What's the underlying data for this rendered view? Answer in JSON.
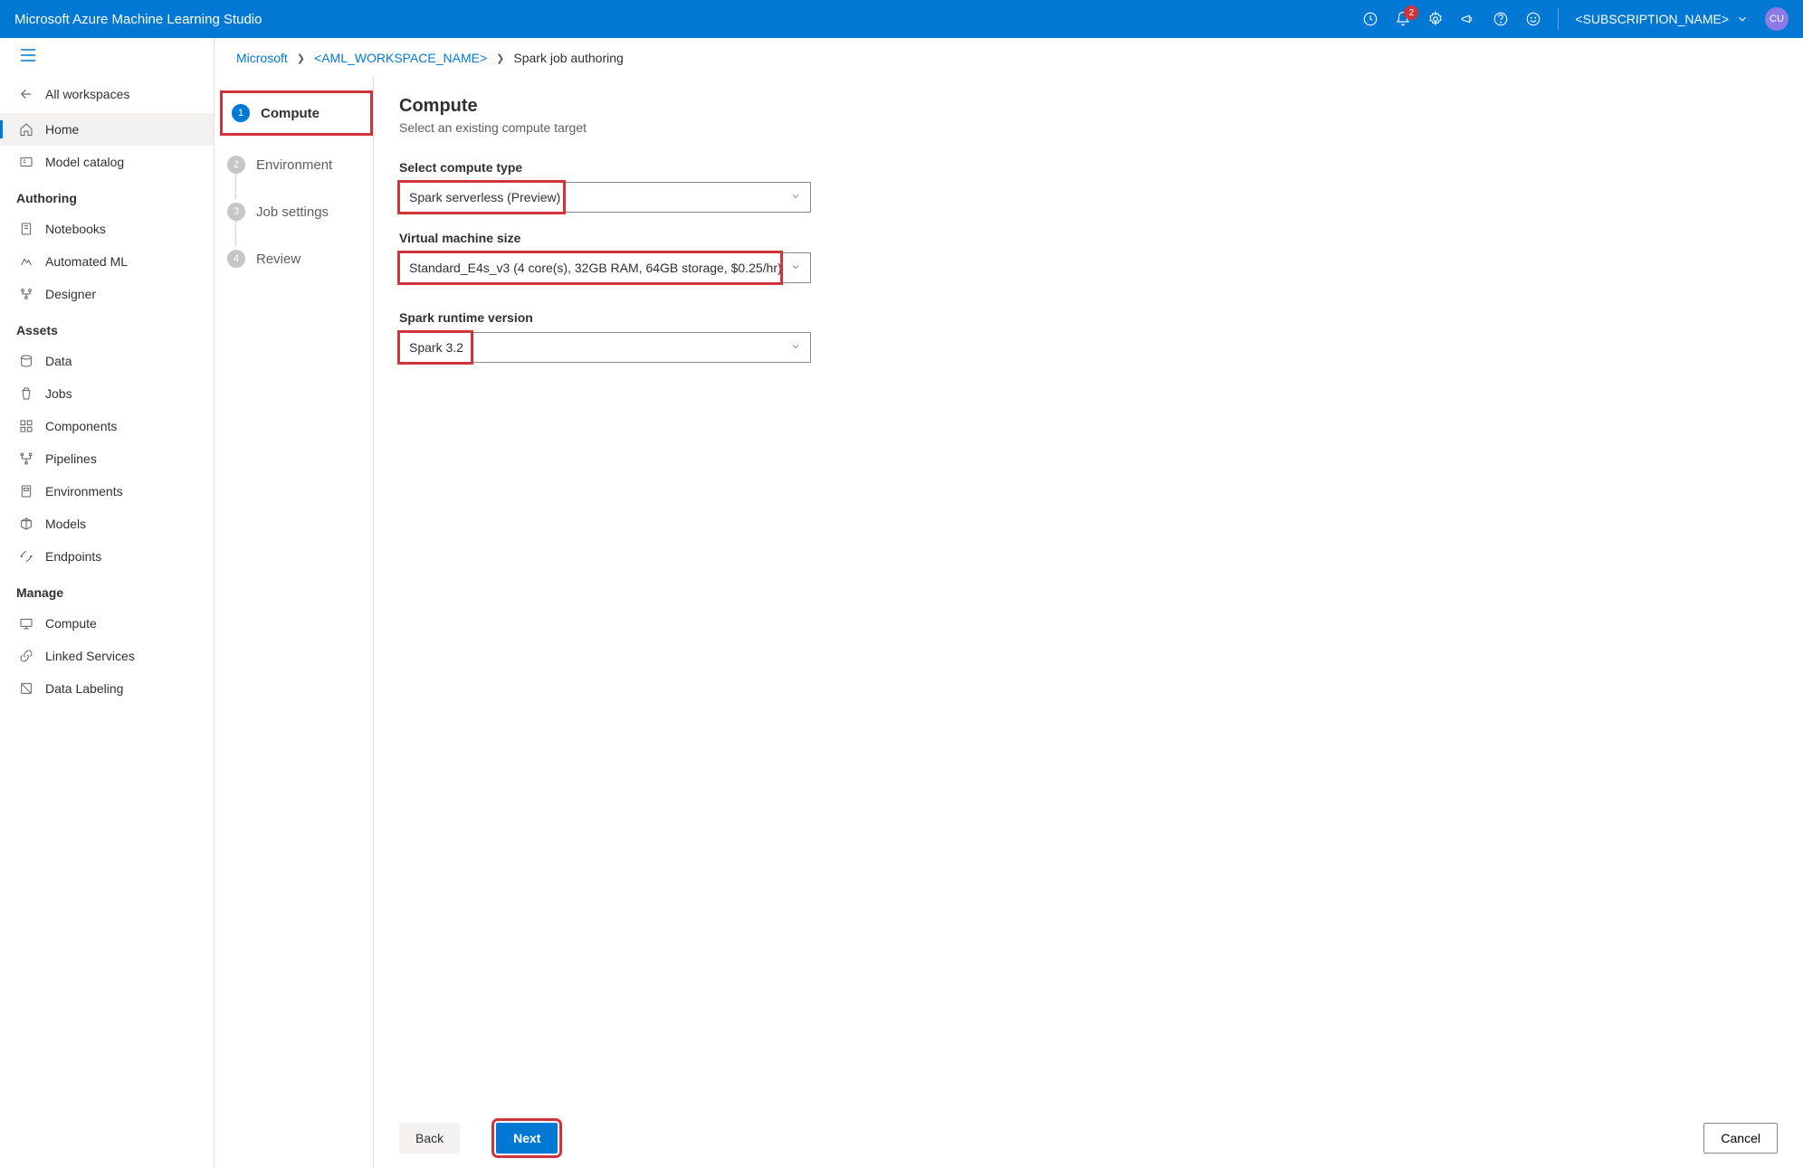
{
  "header": {
    "title": "Microsoft Azure Machine Learning Studio",
    "notification_count": "2",
    "subscription": "<SUBSCRIPTION_NAME>",
    "avatar": "CU"
  },
  "sidebar": {
    "all_workspaces": "All workspaces",
    "home": "Home",
    "model_catalog": "Model catalog",
    "section_authoring": "Authoring",
    "notebooks": "Notebooks",
    "automated_ml": "Automated ML",
    "designer": "Designer",
    "section_assets": "Assets",
    "data": "Data",
    "jobs": "Jobs",
    "components": "Components",
    "pipelines": "Pipelines",
    "environments": "Environments",
    "models": "Models",
    "endpoints": "Endpoints",
    "section_manage": "Manage",
    "compute": "Compute",
    "linked_services": "Linked Services",
    "data_labeling": "Data Labeling"
  },
  "breadcrumb": {
    "root": "Microsoft",
    "workspace": "<AML_WORKSPACE_NAME>",
    "current": "Spark job authoring"
  },
  "steps": {
    "s1": "Compute",
    "s2": "Environment",
    "s3": "Job settings",
    "s4": "Review"
  },
  "form": {
    "title": "Compute",
    "subtitle": "Select an existing compute target",
    "compute_type_label": "Select compute type",
    "compute_type_value": "Spark serverless (Preview)",
    "vm_size_label": "Virtual machine size",
    "vm_size_value": "Standard_E4s_v3 (4 core(s), 32GB RAM, 64GB storage, $0.25/hr)",
    "runtime_label": "Spark runtime version",
    "runtime_value": "Spark 3.2"
  },
  "footer": {
    "back": "Back",
    "next": "Next",
    "cancel": "Cancel"
  }
}
